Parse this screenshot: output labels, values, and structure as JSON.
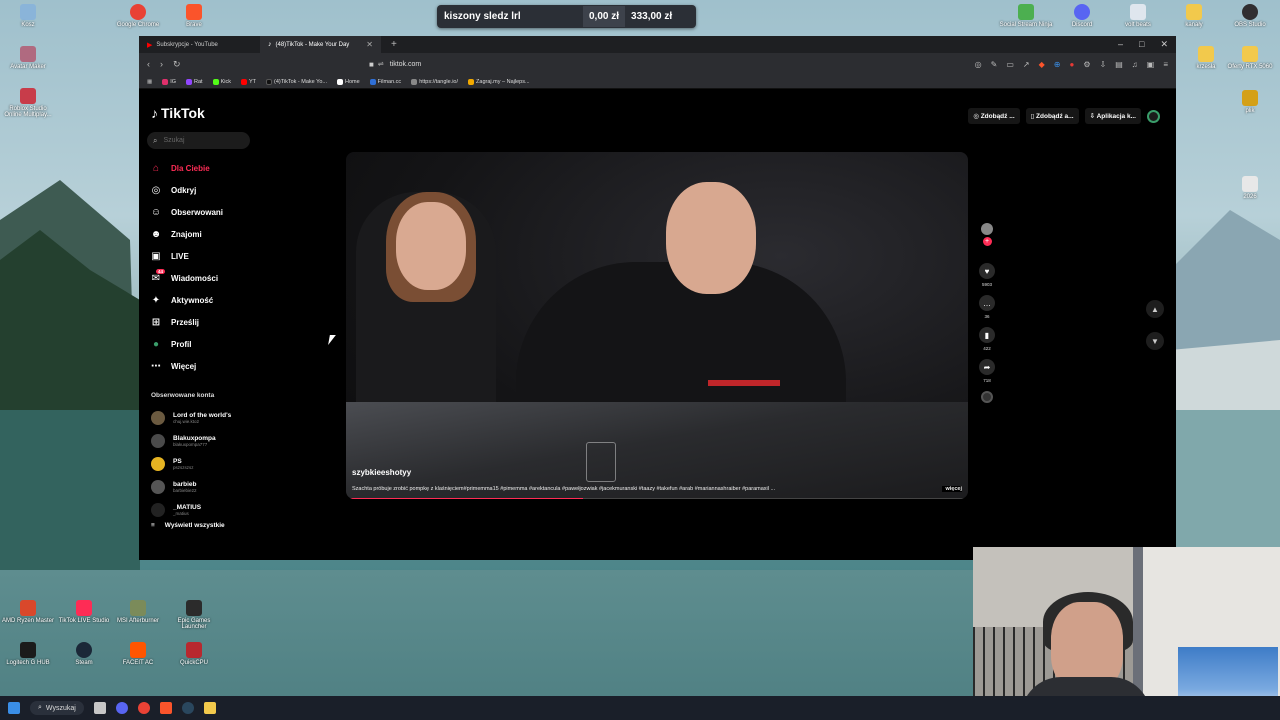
{
  "desktop": {
    "top_icons": [
      {
        "label": "Kosz",
        "color": "#8ab4d9"
      },
      {
        "label": "Google Chrome",
        "color": "#e94235"
      },
      {
        "label": "Brave",
        "color": "#fb542b"
      },
      {
        "label": "Social Stream Ninja",
        "color": "#4caf50"
      },
      {
        "label": "Discord",
        "color": "#5865f2"
      },
      {
        "label": "volt beats",
        "color": "#dfe6ee"
      },
      {
        "label": "kanały",
        "color": "#f2c94c"
      },
      {
        "label": "OBS Studio",
        "color": "#302e31"
      }
    ],
    "left_icons": [
      {
        "label": "Avatar Maker",
        "color": "#b06a80"
      },
      {
        "label": "Roblox Studio Online Multiplay...",
        "color": "#c83c4a"
      }
    ],
    "right_icons": [
      {
        "label": "krzesła",
        "color": "#f2c94c"
      },
      {
        "label": "Oferty RTX 5060",
        "color": "#f2c94c"
      },
      {
        "label": "plik",
        "color": "#d4a017"
      },
      {
        "label": "2026",
        "color": "#e8e8e8"
      }
    ],
    "bottom_icons": [
      {
        "label": "AMD Ryzen Master",
        "color": "#d9482b"
      },
      {
        "label": "TikTok LIVE Studio",
        "color": "#fe2c55"
      },
      {
        "label": "MSI Afterburner",
        "color": "#7b8b5a"
      },
      {
        "label": "Epic Games Launcher",
        "color": "#2b2b2b"
      },
      {
        "label": "Logitech G HUB",
        "color": "#1b1b1b"
      },
      {
        "label": "Steam",
        "color": "#1b2838"
      },
      {
        "label": "FACEIT AC",
        "color": "#ff5500"
      },
      {
        "label": "QuickCPU",
        "color": "#b8282f"
      }
    ]
  },
  "price_banner": {
    "name": "kiszony sledz lrl",
    "value1": "0,00 zł",
    "value2": "333,00 zł"
  },
  "browser": {
    "tabs": [
      {
        "title": "Subskrypcje - YouTube",
        "active": false
      },
      {
        "title": "(48)TikTok - Make Your Day",
        "active": true
      }
    ],
    "new_tab": "+",
    "window_controls": [
      "–",
      "□",
      "✕"
    ],
    "nav_buttons": [
      "‹",
      "›",
      "↻"
    ],
    "url": "tiktok.com",
    "bookmarks": [
      {
        "label": "IG",
        "color": "#e1306c"
      },
      {
        "label": "Rat",
        "color": "#9146ff"
      },
      {
        "label": "Kick",
        "color": "#53fc18"
      },
      {
        "label": "YT",
        "color": "#ff0000"
      },
      {
        "label": "(4)TikTok - Make Yo...",
        "color": "#111111"
      },
      {
        "label": "Home",
        "color": "#ffffff"
      },
      {
        "label": "Filman.cc",
        "color": "#2f6fd6"
      },
      {
        "label": "https://tangle.io/",
        "color": "#888888"
      },
      {
        "label": "Zagraj.my – Najleps...",
        "color": "#f2a900"
      }
    ]
  },
  "tiktok": {
    "logo": "TikTok",
    "search_placeholder": "Szukaj",
    "top_actions": [
      "Zdobądź ...",
      "Zdobądź a...",
      "Aplikacja k..."
    ],
    "nav": [
      {
        "label": "Dla Ciebie",
        "icon": "home-icon",
        "active": true
      },
      {
        "label": "Odkryj",
        "icon": "compass-icon",
        "active": false
      },
      {
        "label": "Obserwowani",
        "icon": "following-icon",
        "active": false
      },
      {
        "label": "Znajomi",
        "icon": "friends-icon",
        "active": false
      },
      {
        "label": "LIVE",
        "icon": "live-icon",
        "active": false
      },
      {
        "label": "Wiadomości",
        "icon": "messages-icon",
        "active": false
      },
      {
        "label": "Aktywność",
        "icon": "activity-icon",
        "active": false
      },
      {
        "label": "Prześlij",
        "icon": "upload-icon",
        "active": false
      },
      {
        "label": "Profil",
        "icon": "profile-icon",
        "active": false
      },
      {
        "label": "Więcej",
        "icon": "more-icon",
        "active": false
      }
    ],
    "messages_badge": "44",
    "followed_title": "Obserwowane konta",
    "followed": [
      {
        "name": "Lord of the world's",
        "handle": "chuj.wie.kto2"
      },
      {
        "name": "Blakuxpompa",
        "handle": "blakuxpompa777"
      },
      {
        "name": "PS",
        "handle": "pszszszsz"
      },
      {
        "name": "barbieb",
        "handle": "barbiebie22"
      },
      {
        "name": "_MATIUS",
        "handle": "_matius"
      }
    ],
    "show_all": "Wyświetl wszystkie",
    "video": {
      "username": "szybkieeshotyy",
      "description": "Szachta próbuje zrobić pompkę z klaśnięciem#primemma15 #pimemma #arektancula #pawełjozwiak #jacekmuranski #taazy #takefun #arab #mariannashraiber #paramaxil ...",
      "more": "więcej",
      "progress": 0.38
    },
    "actions": {
      "likes": "5903",
      "comments": "36",
      "saves": "422",
      "shares": "718"
    }
  },
  "taskbar": {
    "search": "Wyszukaj",
    "apps": [
      {
        "icon": "start-icon",
        "color": "#3a8ee6"
      },
      {
        "icon": "files-icon",
        "color": "#c7c7c7"
      },
      {
        "icon": "discord-icon",
        "color": "#5865f2"
      },
      {
        "icon": "chrome-icon",
        "color": "#e94235"
      },
      {
        "icon": "brave-icon",
        "color": "#fb542b"
      },
      {
        "icon": "steam-icon",
        "color": "#2a475e"
      },
      {
        "icon": "explorer-icon",
        "color": "#f2c94c"
      }
    ]
  }
}
